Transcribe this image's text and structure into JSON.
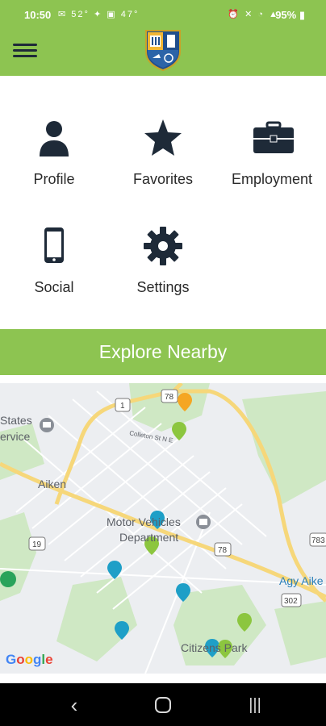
{
  "status_bar": {
    "time": "10:50",
    "temperature": "52°",
    "temperature2": "47°",
    "battery": "95%"
  },
  "header": {
    "menu_icon": "hamburger-icon",
    "logo_icon": "university-crest-logo"
  },
  "grid": [
    {
      "label": "Profile",
      "icon": "person-icon"
    },
    {
      "label": "Favorites",
      "icon": "star-icon"
    },
    {
      "label": "Employment",
      "icon": "briefcase-icon"
    },
    {
      "label": "Social",
      "icon": "smartphone-icon"
    },
    {
      "label": "Settings",
      "icon": "gear-icon"
    }
  ],
  "explore": {
    "label": "Explore Nearby"
  },
  "map": {
    "labels": {
      "states_service_1": "States",
      "states_service_2": "ervice",
      "aiken": "Aiken",
      "motor_vehicles_1": "Motor Vehicles",
      "motor_vehicles_2": "Department",
      "agy": "Agy Aike",
      "citizens_park": "Citizens Park",
      "route_1": "1",
      "route_78a": "78",
      "route_78b": "78",
      "route_19": "19",
      "route_783": "783",
      "route_302": "302",
      "road_small": "Colleton St N E"
    },
    "google": "Google"
  },
  "colors": {
    "brand_green": "#8dc451",
    "icon_navy": "#1e2a38",
    "pin_blue": "#1e9fc7",
    "pin_green": "#8cc63f",
    "pin_orange": "#f5a623"
  }
}
